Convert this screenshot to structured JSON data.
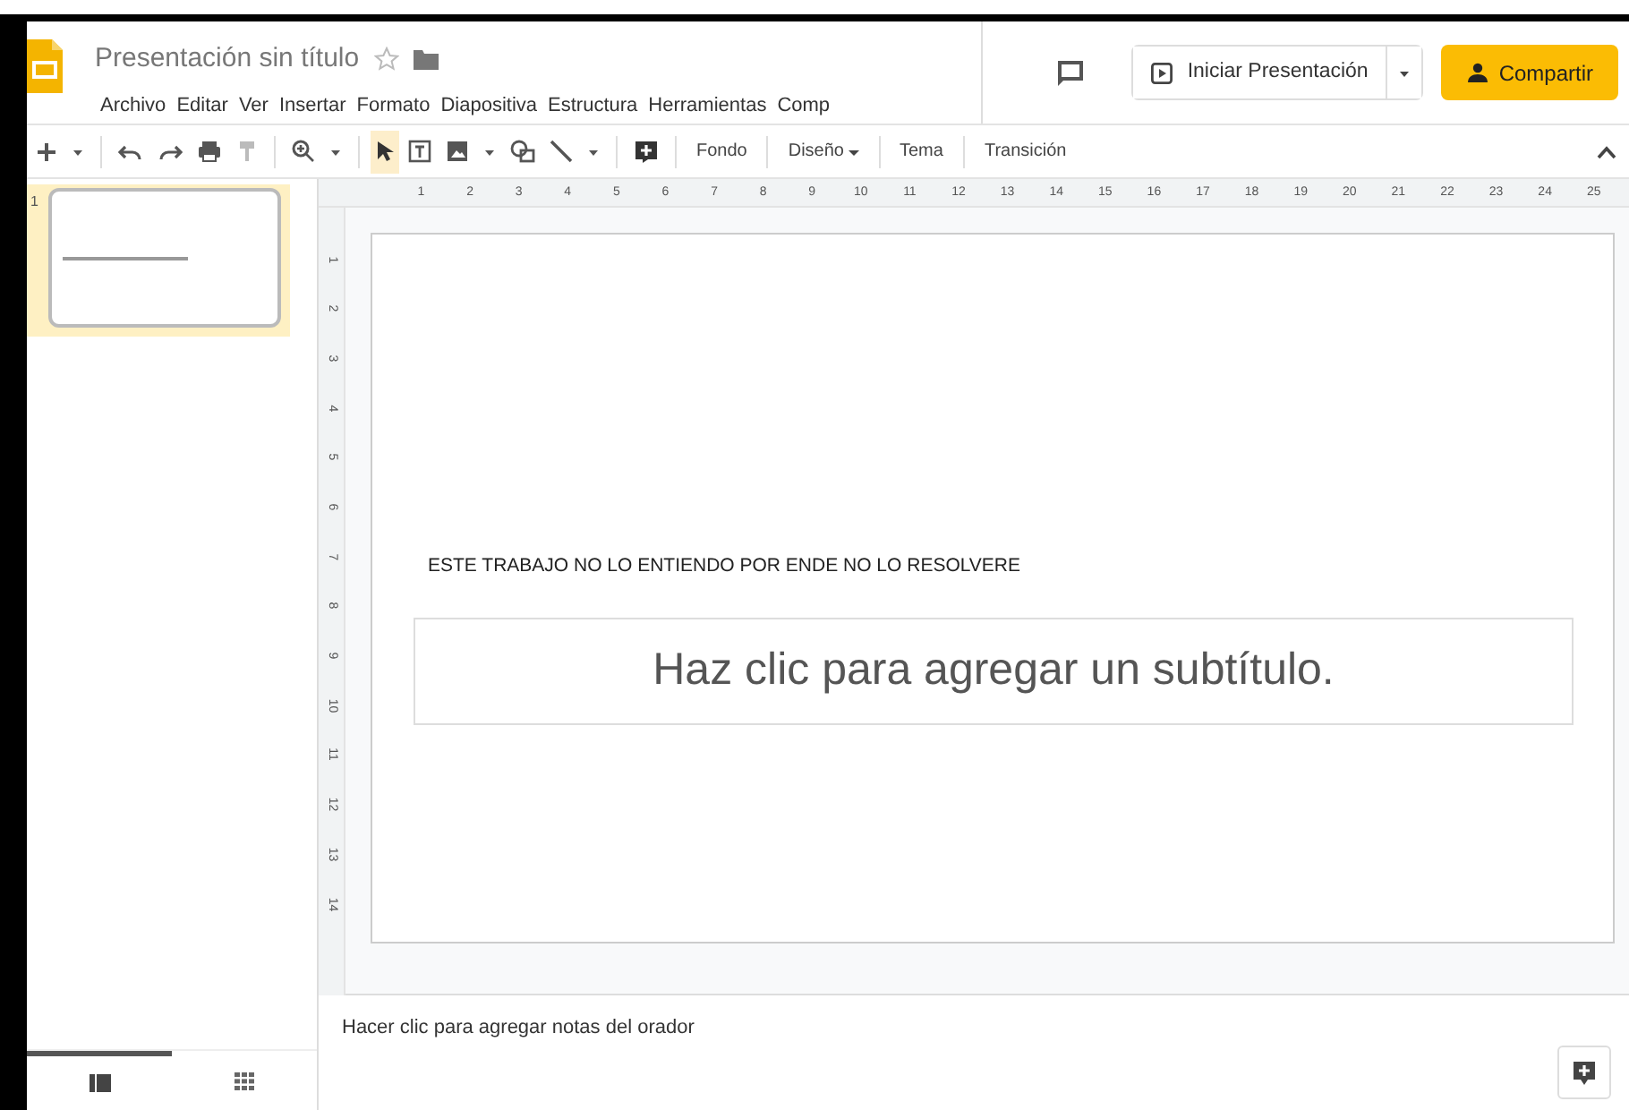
{
  "document": {
    "title": "Presentación sin título",
    "starred": false
  },
  "menu": [
    "Archivo",
    "Editar",
    "Ver",
    "Insertar",
    "Formato",
    "Diapositiva",
    "Estructura",
    "Herramientas",
    "Comp"
  ],
  "header_actions": {
    "present_label": "Iniciar Presentación",
    "share_label": "Compartir"
  },
  "toolbar": {
    "tool_groups": [
      [
        {
          "kind": "plus",
          "selected": false
        },
        {
          "kind": "dropdown",
          "selected": false
        }
      ],
      [
        {
          "kind": "undo",
          "selected": false
        },
        {
          "kind": "redo",
          "selected": false
        },
        {
          "kind": "print",
          "selected": false
        },
        {
          "kind": "paint",
          "selected": false
        }
      ],
      [
        {
          "kind": "zoom",
          "selected": false
        },
        {
          "kind": "dropdown",
          "selected": false
        }
      ],
      [
        {
          "kind": "select",
          "selected": true
        },
        {
          "kind": "textbox",
          "selected": false
        },
        {
          "kind": "image",
          "selected": false
        },
        {
          "kind": "dropdown",
          "selected": false
        },
        {
          "kind": "shape",
          "selected": false
        },
        {
          "kind": "line",
          "selected": false
        },
        {
          "kind": "dropdown",
          "selected": false
        }
      ],
      [
        {
          "kind": "comment",
          "selected": false
        }
      ]
    ],
    "text_buttons": [
      {
        "label": "Fondo",
        "dropdown": false
      },
      {
        "label": "Diseño",
        "dropdown": true
      },
      {
        "label": "Tema",
        "dropdown": false
      },
      {
        "label": "Transición",
        "dropdown": false
      }
    ]
  },
  "filmstrip": {
    "slides": [
      {
        "number": "1",
        "selected": true
      }
    ],
    "views": [
      {
        "kind": "list",
        "selected": true
      },
      {
        "kind": "grid",
        "selected": false
      }
    ]
  },
  "rulers": {
    "horizontal": [
      "1",
      "2",
      "3",
      "4",
      "5",
      "6",
      "7",
      "8",
      "9",
      "10",
      "11",
      "12",
      "13",
      "14",
      "15",
      "16",
      "17",
      "18",
      "19",
      "20",
      "21",
      "22",
      "23",
      "24",
      "25"
    ],
    "vertical": [
      "1",
      "2",
      "3",
      "4",
      "5",
      "6",
      "7",
      "8",
      "9",
      "10",
      "11",
      "12",
      "13",
      "14"
    ]
  },
  "slide": {
    "title": "ESTE TRABAJO NO LO ENTIENDO POR ENDE NO LO RESOLVERE",
    "subtitle_placeholder": "Haz clic para agregar un subtítulo."
  },
  "notes": {
    "placeholder": "Hacer clic para agregar notas del orador"
  }
}
